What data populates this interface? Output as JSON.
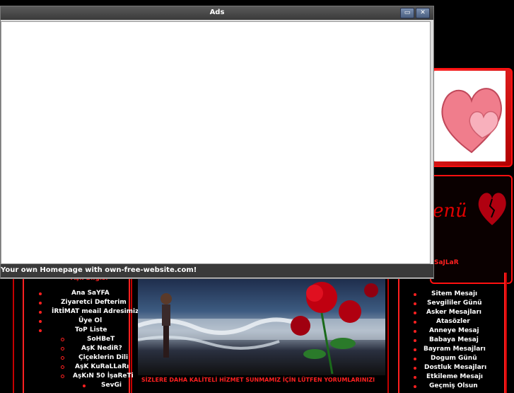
{
  "ads_window": {
    "title": "Ads",
    "minimize_label": "▭",
    "close_label": "✕",
    "footer_text": "Your own Homepage with own-free-website.com!"
  },
  "left_panel": {
    "heading": "Aşk Bilgisi",
    "menu": [
      {
        "label": "Ana SaYFA",
        "level": 1
      },
      {
        "label": "Ziyaretci Defterim",
        "level": 1
      },
      {
        "label": "İRtİMAT meail Adresimiz",
        "level": 1
      },
      {
        "label": "Üye Ol",
        "level": 1
      },
      {
        "label": "ToP Liste",
        "level": 1
      },
      {
        "label": "SoHBeT",
        "level": 2
      },
      {
        "label": "AşK NediR?",
        "level": 2
      },
      {
        "label": "Çiçeklerin Dili",
        "level": 2
      },
      {
        "label": "AşK KuRaLLaRı",
        "level": 2
      },
      {
        "label": "AşKıN 50 İşaReTi",
        "level": 2
      },
      {
        "label": "SevGi",
        "level": 2
      }
    ]
  },
  "right_panel": {
    "menu_word": "enü",
    "heading": "SaJLaR",
    "menu": [
      "Sitem Mesajı",
      "Sevgililer Günü",
      "Asker Mesajları",
      "Atasözler",
      "Anneye Mesaj",
      "Babaya Mesaj",
      "Bayram Mesajları",
      "Dogum Günü",
      "Dostluk Mesajları",
      "Etkileme Mesajı",
      "Geçmiş Olsun"
    ]
  },
  "center": {
    "slogan": "SİZLERE DAHA KALİTELİ HİZMET SUNMAMIZ İÇİN LÜTFEN YORUMLARINIZI"
  },
  "colors": {
    "background": "#000000",
    "accent": "#ff2020",
    "window_bg": "#dcdcdc"
  }
}
